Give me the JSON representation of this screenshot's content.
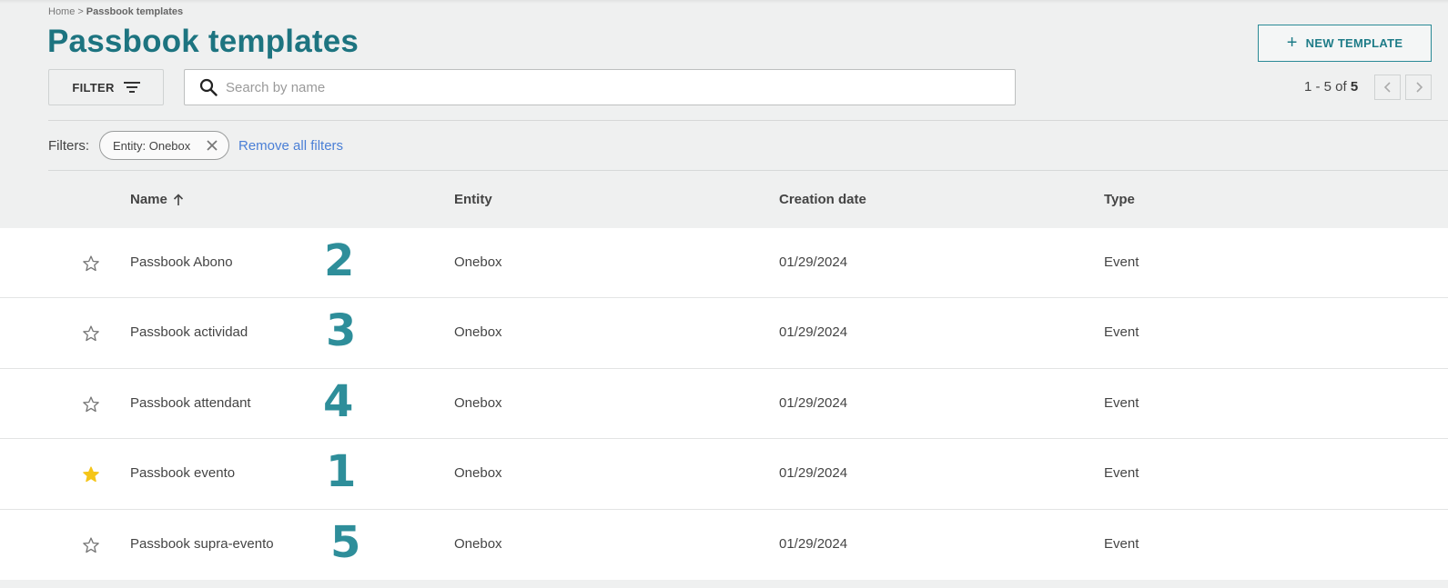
{
  "breadcrumb": {
    "home": "Home",
    "separator": ">",
    "current": "Passbook templates"
  },
  "page": {
    "title": "Passbook templates"
  },
  "toolbar": {
    "new_template_label": "NEW TEMPLATE",
    "filter_label": "FILTER",
    "search_placeholder": "Search by name",
    "search_value": ""
  },
  "pager": {
    "range": "1 - 5 of",
    "total": "5"
  },
  "filters": {
    "label": "Filters:",
    "chips": [
      {
        "label": "Entity: Onebox"
      }
    ],
    "remove_all_label": "Remove all filters"
  },
  "table": {
    "columns": {
      "name": "Name",
      "entity": "Entity",
      "creation_date": "Creation date",
      "type": "Type"
    },
    "sort": {
      "column": "name",
      "direction": "ascending"
    },
    "rows": [
      {
        "favorite": false,
        "name": "Passbook Abono",
        "annotation": "2",
        "entity": "Onebox",
        "creation_date": "01/29/2024",
        "type": "Event"
      },
      {
        "favorite": false,
        "name": "Passbook actividad",
        "annotation": "3",
        "entity": "Onebox",
        "creation_date": "01/29/2024",
        "type": "Event"
      },
      {
        "favorite": false,
        "name": "Passbook attendant",
        "annotation": "4",
        "entity": "Onebox",
        "creation_date": "01/29/2024",
        "type": "Event"
      },
      {
        "favorite": true,
        "name": "Passbook evento",
        "annotation": "1",
        "entity": "Onebox",
        "creation_date": "01/29/2024",
        "type": "Event"
      },
      {
        "favorite": false,
        "name": "Passbook supra-evento",
        "annotation": "5",
        "entity": "Onebox",
        "creation_date": "01/29/2024",
        "type": "Event"
      }
    ]
  },
  "colors": {
    "brand": "#1d7480",
    "annotation": "#2e8e9a",
    "link": "#4a7fd6",
    "favorite_star": "#f5c518",
    "star_outline": "#777777"
  },
  "icons": {
    "plus": "plus-icon",
    "filter": "filter-lines-icon",
    "search": "search-icon",
    "prev": "chevron-left-icon",
    "next": "chevron-right-icon",
    "chip_remove": "close-icon",
    "sort": "arrow-up-icon",
    "favorite": "star-icon"
  }
}
